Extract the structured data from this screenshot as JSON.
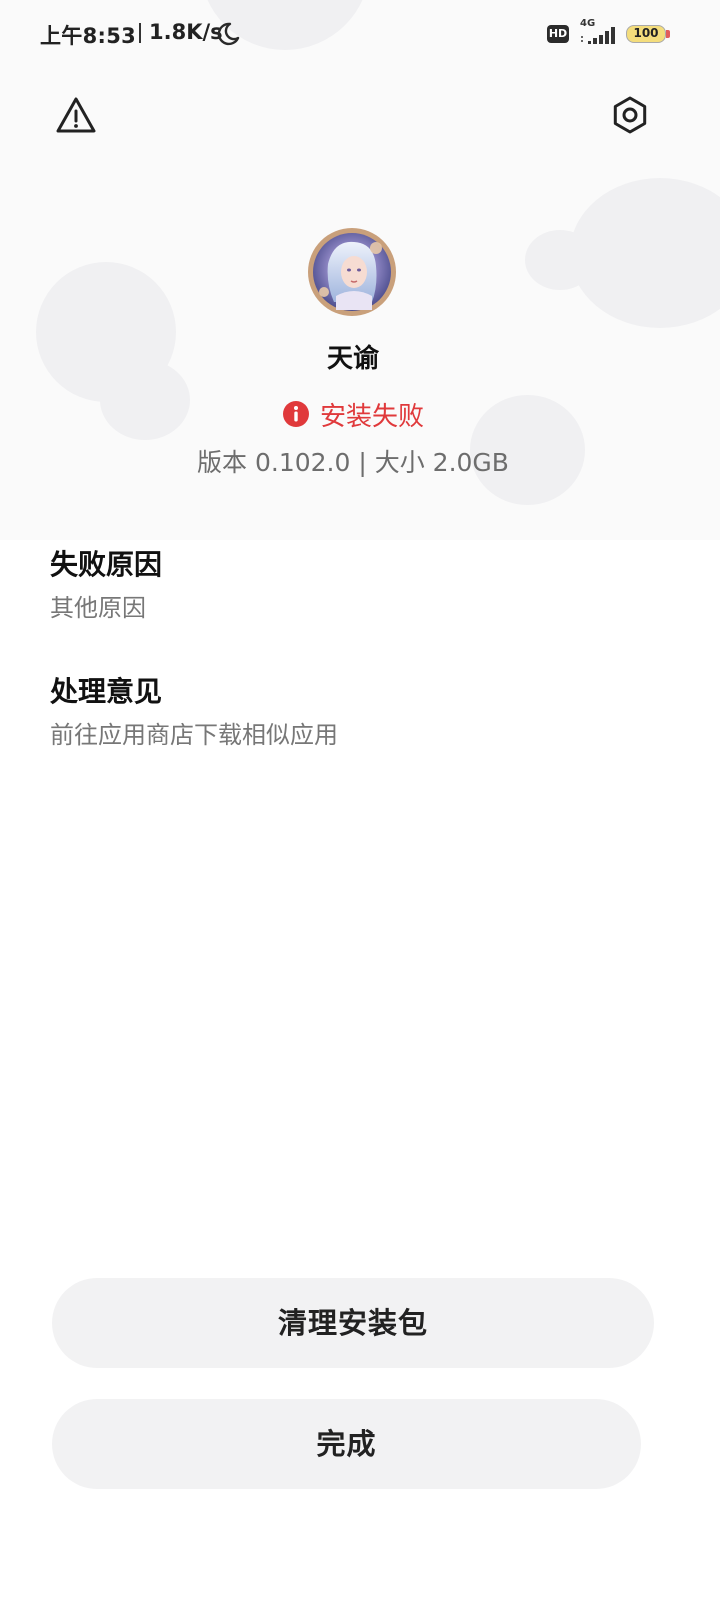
{
  "status_bar": {
    "time": "上午8:53",
    "speed": "1.8K/s",
    "hd_label": "HD",
    "network": "4G",
    "battery": "100",
    "icons": [
      "moon-icon",
      "signal-icon",
      "battery-icon"
    ]
  },
  "toolbar": {
    "left_icon": "warning-icon",
    "right_icon": "settings-icon"
  },
  "app": {
    "name": "天谕",
    "status": "安装失败",
    "meta": "版本 0.102.0 | 大小 2.0GB"
  },
  "sections": {
    "reason": {
      "title": "失败原因",
      "text": "其他原因"
    },
    "advice": {
      "title": "处理意见",
      "text": "前往应用商店下载相似应用"
    }
  },
  "buttons": {
    "clean": "清理安装包",
    "done": "完成"
  },
  "colors": {
    "error": "#e0393b",
    "button_bg": "#f2f2f3",
    "hero_bg": "#fafafa"
  }
}
